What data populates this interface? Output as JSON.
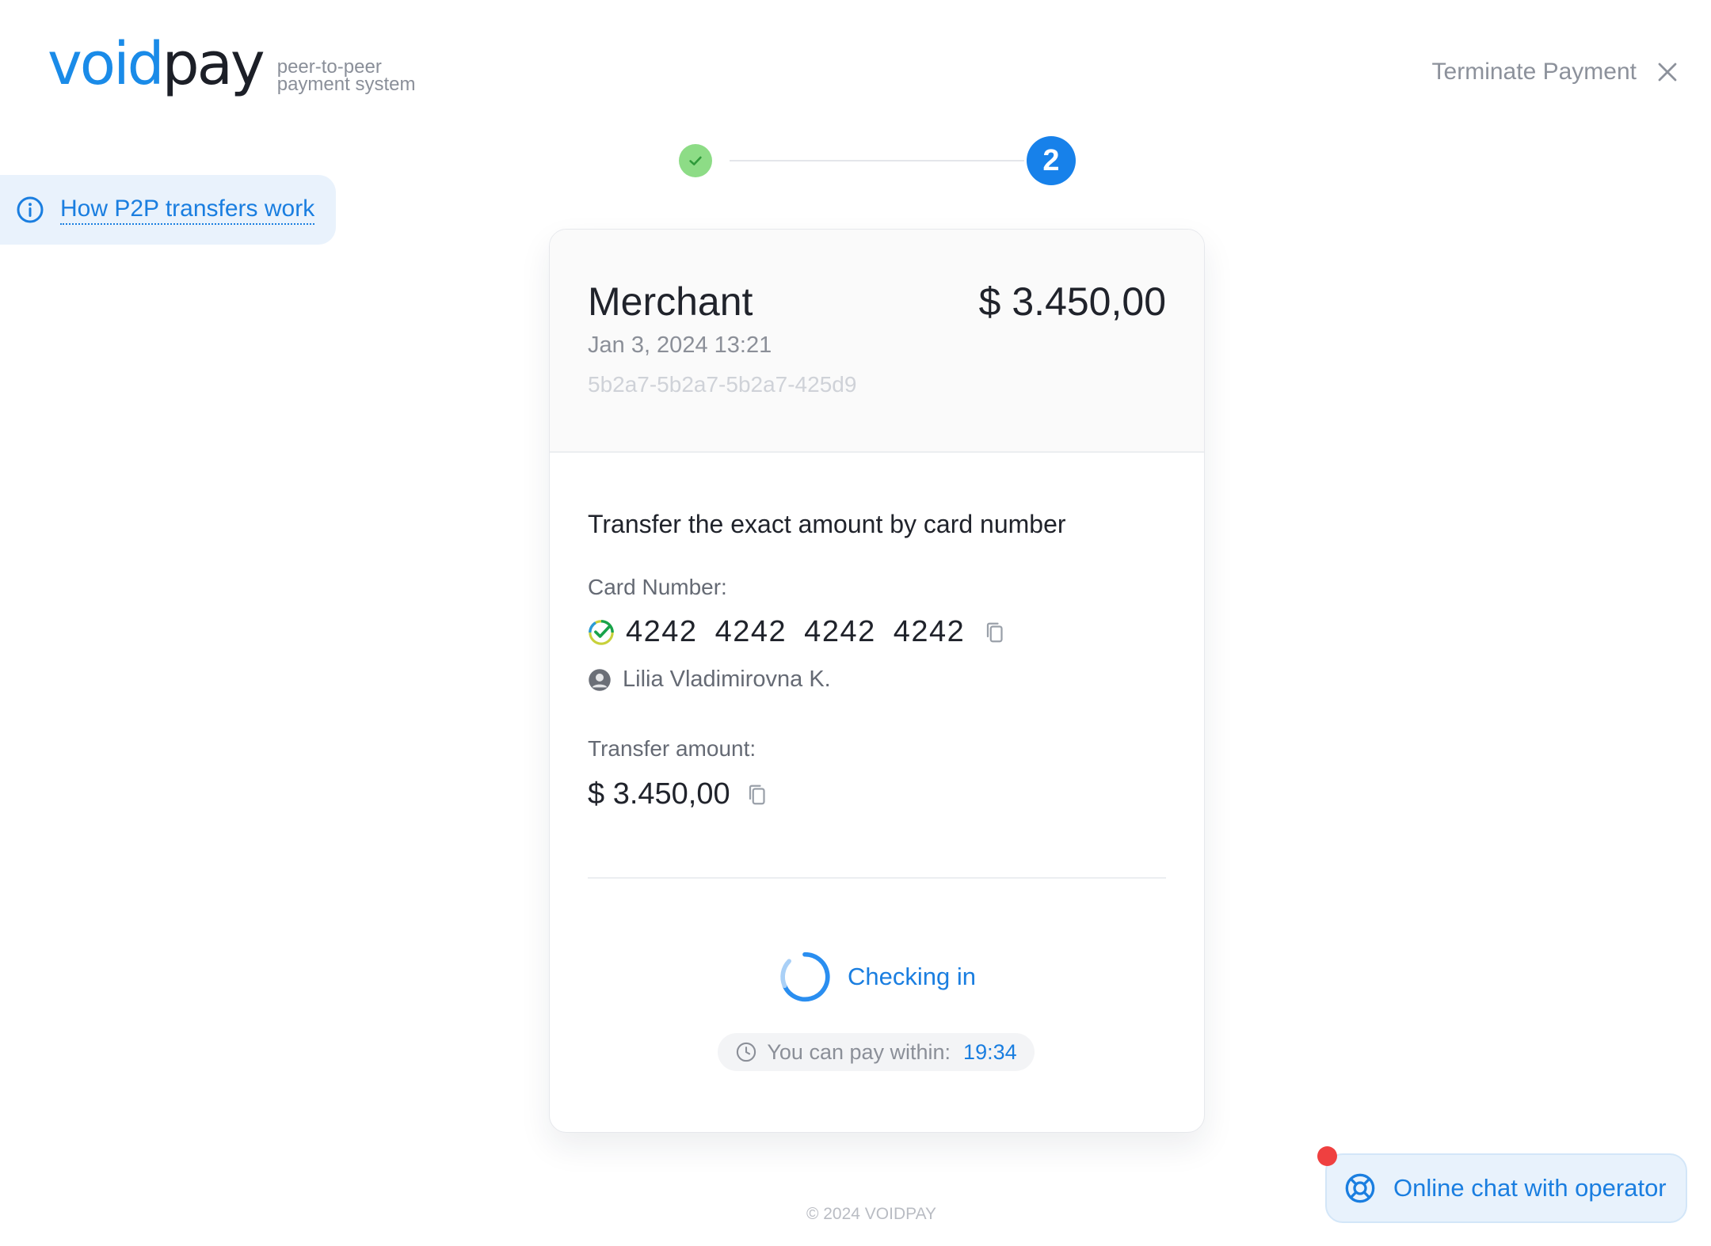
{
  "brand": {
    "logo_void": "void",
    "logo_pay": "pay",
    "tagline_line1": "peer-to-peer",
    "tagline_line2": "payment system"
  },
  "header": {
    "terminate_label": "Terminate Payment"
  },
  "help": {
    "how_link": "How P2P transfers work"
  },
  "stepper": {
    "active_step": "2"
  },
  "merchant": {
    "name": "Merchant",
    "amount": "$ 3.450,00",
    "date": "Jan 3, 2024 13:21",
    "order_id": "5b2a7-5b2a7-5b2a7-425d9"
  },
  "transfer": {
    "instruction": "Transfer the exact amount by card number",
    "card_label": "Card Number:",
    "card_number": "4242 4242 4242 4242",
    "holder": "Lilia Vladimirovna K.",
    "amount_label": "Transfer amount:",
    "amount": "$ 3.450,00"
  },
  "status": {
    "checking_label": "Checking in",
    "timer_label": "You can pay within:",
    "timer_value": "19:34"
  },
  "footer": {
    "copyright": "© 2024 VOIDPAY"
  },
  "chat": {
    "label": "Online chat with operator"
  },
  "colors": {
    "accent": "#1a7ee0",
    "success": "#8ddc86",
    "notification": "#ef4040"
  }
}
